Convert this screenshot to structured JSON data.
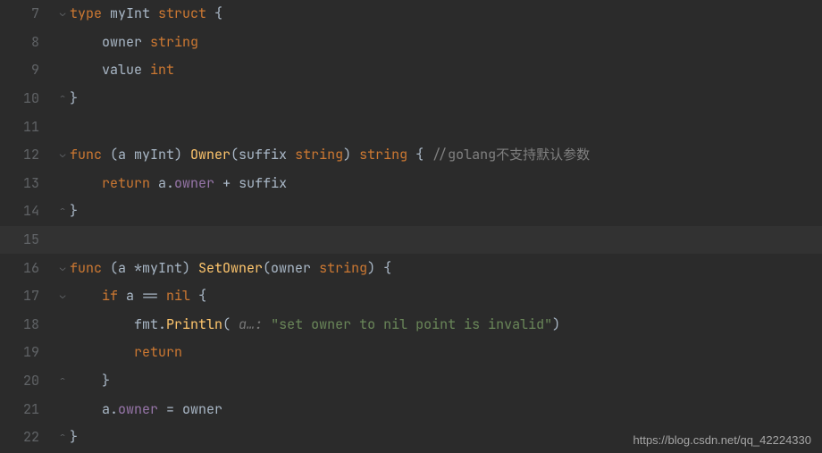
{
  "lines": [
    {
      "num": 7,
      "fold": "⌄",
      "active": false,
      "tokens": [
        {
          "t": "type ",
          "c": "kw"
        },
        {
          "t": "myInt ",
          "c": "punct"
        },
        {
          "t": "struct ",
          "c": "kw"
        },
        {
          "t": "{",
          "c": "punct"
        }
      ]
    },
    {
      "num": 8,
      "fold": "",
      "active": false,
      "tokens": [
        {
          "t": "    owner ",
          "c": "punct"
        },
        {
          "t": "string",
          "c": "type"
        }
      ]
    },
    {
      "num": 9,
      "fold": "",
      "active": false,
      "tokens": [
        {
          "t": "    value ",
          "c": "punct"
        },
        {
          "t": "int",
          "c": "type"
        }
      ]
    },
    {
      "num": 10,
      "fold": "⌃",
      "active": false,
      "tokens": [
        {
          "t": "}",
          "c": "punct"
        }
      ]
    },
    {
      "num": 11,
      "fold": "",
      "active": false,
      "tokens": []
    },
    {
      "num": 12,
      "fold": "⌄",
      "active": false,
      "tokens": [
        {
          "t": "func ",
          "c": "kw"
        },
        {
          "t": "(a myInt) ",
          "c": "punct"
        },
        {
          "t": "Owner",
          "c": "fn"
        },
        {
          "t": "(suffix ",
          "c": "punct"
        },
        {
          "t": "string",
          "c": "type"
        },
        {
          "t": ") ",
          "c": "punct"
        },
        {
          "t": "string ",
          "c": "type"
        },
        {
          "t": "{ ",
          "c": "punct"
        },
        {
          "t": "//golang不支持默认参数",
          "c": "cmt"
        }
      ]
    },
    {
      "num": 13,
      "fold": "",
      "active": false,
      "tokens": [
        {
          "t": "    ",
          "c": "punct"
        },
        {
          "t": "return ",
          "c": "kw"
        },
        {
          "t": "a.",
          "c": "punct"
        },
        {
          "t": "owner",
          "c": "field"
        },
        {
          "t": " + suffix",
          "c": "punct"
        }
      ]
    },
    {
      "num": 14,
      "fold": "⌃",
      "active": false,
      "tokens": [
        {
          "t": "}",
          "c": "punct"
        }
      ]
    },
    {
      "num": 15,
      "fold": "",
      "active": true,
      "tokens": []
    },
    {
      "num": 16,
      "fold": "⌄",
      "active": false,
      "tokens": [
        {
          "t": "func ",
          "c": "kw"
        },
        {
          "t": "(a *myInt) ",
          "c": "punct"
        },
        {
          "t": "SetOwner",
          "c": "fn"
        },
        {
          "t": "(owner ",
          "c": "punct"
        },
        {
          "t": "string",
          "c": "type"
        },
        {
          "t": ") {",
          "c": "punct"
        }
      ]
    },
    {
      "num": 17,
      "fold": "⌄",
      "active": false,
      "tokens": [
        {
          "t": "    ",
          "c": "punct"
        },
        {
          "t": "if ",
          "c": "kw"
        },
        {
          "t": "a == ",
          "c": "punct"
        },
        {
          "t": "nil ",
          "c": "kw"
        },
        {
          "t": "{",
          "c": "punct"
        }
      ]
    },
    {
      "num": 18,
      "fold": "",
      "active": false,
      "tokens": [
        {
          "t": "        fmt.",
          "c": "punct"
        },
        {
          "t": "Println",
          "c": "fn"
        },
        {
          "t": "( ",
          "c": "punct"
        },
        {
          "t": "a…: ",
          "c": "hint"
        },
        {
          "t": "\"set owner to nil point is invalid\"",
          "c": "str"
        },
        {
          "t": ")",
          "c": "punct"
        }
      ]
    },
    {
      "num": 19,
      "fold": "",
      "active": false,
      "tokens": [
        {
          "t": "        ",
          "c": "punct"
        },
        {
          "t": "return",
          "c": "kw"
        }
      ]
    },
    {
      "num": 20,
      "fold": "⌃",
      "active": false,
      "tokens": [
        {
          "t": "    }",
          "c": "punct"
        }
      ]
    },
    {
      "num": 21,
      "fold": "",
      "active": false,
      "tokens": [
        {
          "t": "    a.",
          "c": "punct"
        },
        {
          "t": "owner",
          "c": "field"
        },
        {
          "t": " = owner",
          "c": "punct"
        }
      ]
    },
    {
      "num": 22,
      "fold": "⌃",
      "active": false,
      "tokens": [
        {
          "t": "}",
          "c": "punct"
        }
      ]
    }
  ],
  "watermark": "https://blog.csdn.net/qq_42224330"
}
